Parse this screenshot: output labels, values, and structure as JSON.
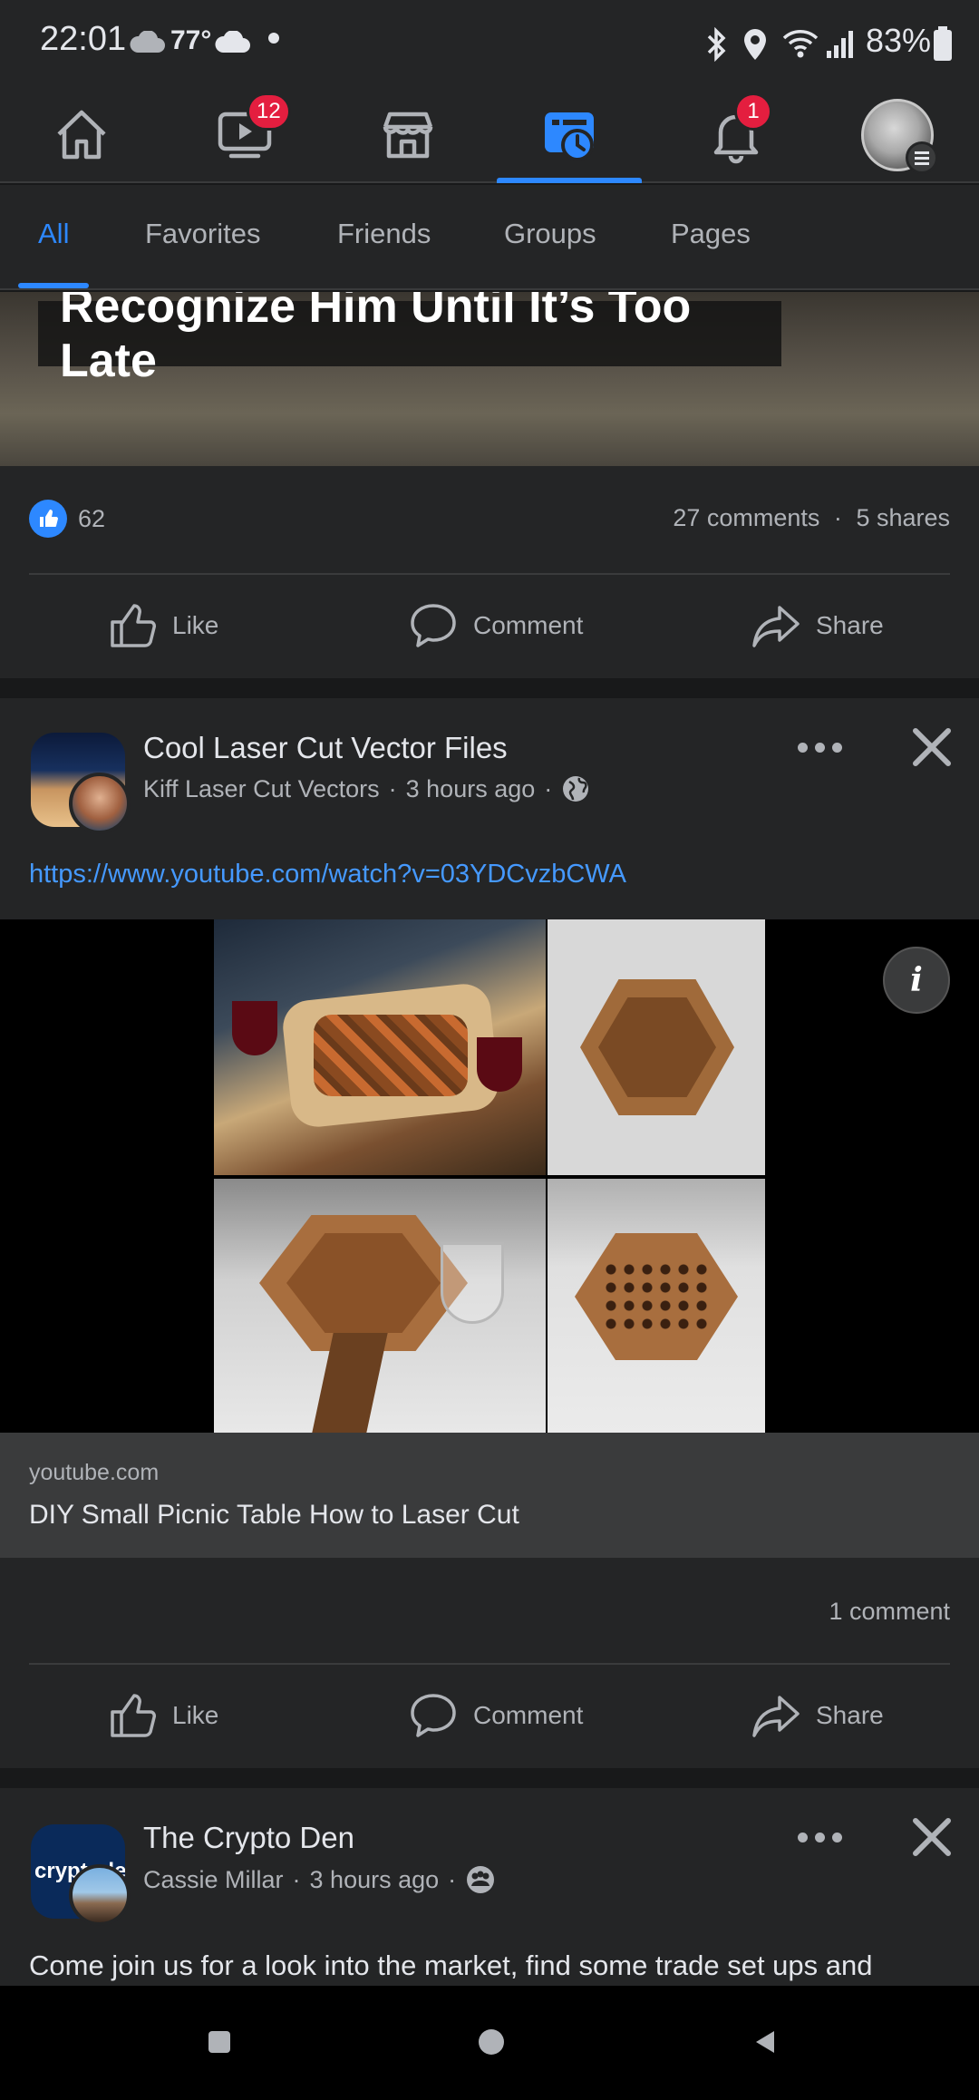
{
  "status_bar": {
    "time": "22:01",
    "temperature": "77°",
    "battery": "83%"
  },
  "nav": {
    "items": [
      {
        "name": "home"
      },
      {
        "name": "watch",
        "badge": "12"
      },
      {
        "name": "marketplace"
      },
      {
        "name": "feeds"
      },
      {
        "name": "notifications",
        "badge": "1"
      },
      {
        "name": "menu"
      }
    ]
  },
  "tabs": [
    "All",
    "Favorites",
    "Friends",
    "Groups",
    "Pages"
  ],
  "post1": {
    "image_caption": "Recognize Him Until It’s Too Late",
    "like_count": "62",
    "comments": "27 comments",
    "shares": "5 shares",
    "actions": {
      "like": "Like",
      "comment": "Comment",
      "share": "Share"
    }
  },
  "post2": {
    "page_name": "Cool Laser Cut Vector Files",
    "author": "Kiff Laser Cut Vectors",
    "time": "3 hours ago",
    "link": "https://www.youtube.com/watch?v=03YDCvzbCWA",
    "preview_domain": "youtube.com",
    "preview_title": "DIY Small Picnic Table How to Laser Cut",
    "comments": "1 comment",
    "info_icon": "i",
    "actions": {
      "like": "Like",
      "comment": "Comment",
      "share": "Share"
    }
  },
  "post3": {
    "page_name": "The Crypto Den",
    "author": "Cassie Millar",
    "time": "3 hours ago",
    "avatar_text": "cryptoden",
    "body": "Come join us for a look into the market, find some trade set ups and"
  },
  "separator": "·",
  "colors": {
    "accent": "#2d88ff",
    "badge": "#e41e3f",
    "background": "#18191a",
    "card": "#242526"
  }
}
